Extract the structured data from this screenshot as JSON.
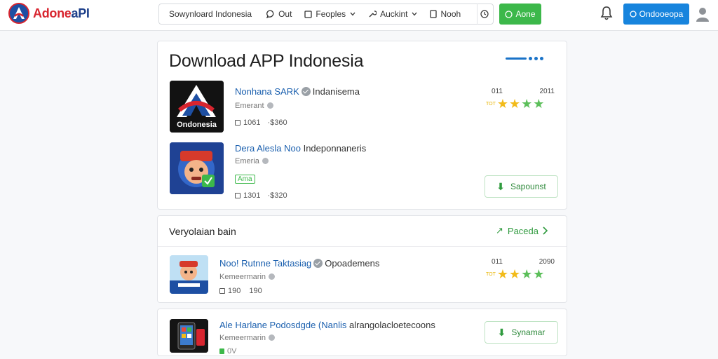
{
  "colors": {
    "accent_blue": "#1784dd",
    "accent_green": "#3cb84a",
    "link_blue": "#1a5fae",
    "star_yellow": "#f2bb1a",
    "star_green": "#5cbf5a"
  },
  "header": {
    "brand": {
      "part1": "Adone",
      "part2": "aPI"
    },
    "nav": [
      {
        "label": "Sowynloard Indonesia",
        "icon": "none"
      },
      {
        "label": "Out",
        "icon": "chat-bubble-icon"
      },
      {
        "label": "Feoples",
        "icon": "square-icon",
        "dropdown": true
      },
      {
        "label": "Auckint",
        "icon": "wrench-icon",
        "dropdown": true
      },
      {
        "label": "Nooh",
        "icon": "phone-icon"
      }
    ],
    "green_button": "Aone",
    "blue_button": "Ondooeopa"
  },
  "main": {
    "title": "Download APP Indonesia",
    "apps": [
      {
        "icon_caption": "Ondonesia",
        "name": "Nonhana SARK",
        "developer": "Indanisema",
        "subtitle": "Emerant",
        "stat1": "1061",
        "stat2": "·$360",
        "rating_left": "011",
        "rating_right": "2011",
        "rating_tiny": "TOT",
        "stars_yellow": 2,
        "stars_green": 2
      },
      {
        "name": "Dera Alesla Noo",
        "developer": "Indeponnaneris",
        "subtitle": "Emeria",
        "badge": "Ama",
        "stat1": "1301",
        "stat2": "·$320",
        "button": "Sapounst"
      }
    ]
  },
  "section": {
    "title": "Veryolaian bain",
    "link": "Paceda",
    "app": {
      "name": "Noo! Rutnne Taktasiag",
      "developer": "Opoademens",
      "subtitle": "Kemeermarin",
      "stat1": "190",
      "stat2": "190",
      "rating_left": "011",
      "rating_right": "2090",
      "rating_tiny": "TOT",
      "stars_yellow": 2,
      "stars_green": 2
    }
  },
  "row": {
    "name": "Ale Harlane Podosdgde (Nanlis",
    "developer": "alrangolacloetecoons",
    "subtitle": "Kemeermarin",
    "stat1": "0V",
    "button": "Synamar"
  }
}
